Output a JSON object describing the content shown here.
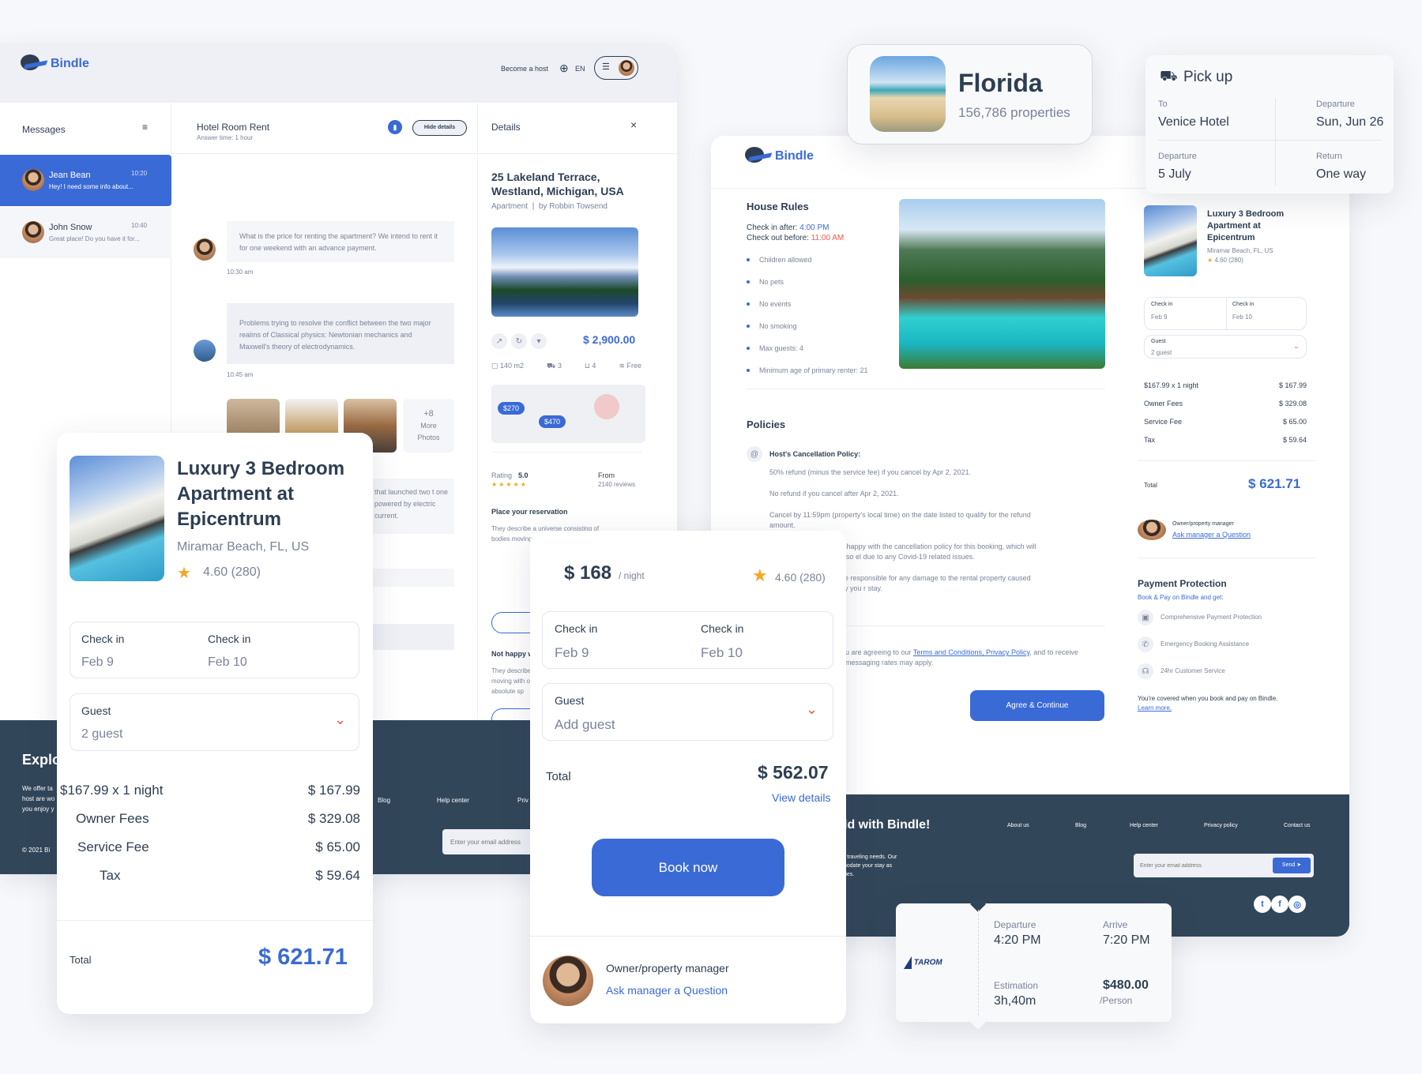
{
  "colors": {
    "accent": "#3a6ad6",
    "dark": "#32465a",
    "warning": "#f2594b",
    "star": "#f5a623"
  },
  "chat_app": {
    "brand": "Bindle",
    "become_host": "Become a host",
    "language": "EN",
    "messages_title": "Messages",
    "conversations": [
      {
        "name": "Jean Bean",
        "time": "10:20",
        "preview": "Hey! I need some info about..."
      },
      {
        "name": "John Snow",
        "time": "10:40",
        "preview": "Great place! Do you have it for..."
      }
    ],
    "chat": {
      "title": "Hotel Room Rent",
      "subtitle": "Answer time: 1 hour",
      "hide_details": "Hide details",
      "messages": [
        {
          "text": "What is the price for renting the apartment? We intend to rent it for one weekend with an advance payment.",
          "time": "10:30 am"
        },
        {
          "text": "Problems trying to resolve the conflict between the two major realms of Classical physics: Newtonian mechanics and Maxwell's theory of electrodynamics.",
          "time": "10:45 am"
        },
        {
          "text": "that launched two t one powered by electric current."
        }
      ],
      "more_photos": "+8",
      "more_photos_label": "More Photos"
    },
    "details": {
      "title": "Details",
      "address": "25 Lakeland Terrace, Westland, Michigan, USA",
      "type": "Apartment",
      "by": "by Robbin Towsend",
      "price": "$ 2,900.00",
      "amenities": [
        "140 m2",
        "3",
        "4",
        "Free"
      ],
      "map_pins": [
        "$270",
        "$470"
      ],
      "rating_label": "Rating",
      "rating": "5.0",
      "from_label": "From",
      "reviews": "2140 reviews",
      "reservation_title": "Place your reservation",
      "reservation_text": "They describe a universe consisting of bodies moving with ... of absolute sp",
      "not_happy_title": "Not happy w",
      "not_happy_text": "They describe moving with of absolute sp"
    },
    "footer": {
      "heading": "Explo",
      "text": "We offer ta host are wo you enjoy y",
      "copyright": "© 2021 Bi",
      "links": [
        "Blog",
        "Help center",
        "Priv"
      ],
      "email_placeholder": "Enter your email address"
    }
  },
  "florida": {
    "title": "Florida",
    "count": "156,786 properties"
  },
  "pickup": {
    "title": "Pick up",
    "to_label": "To",
    "to": "Venice Hotel",
    "dep_label": "Departure",
    "dep": "Sun, Jun 26",
    "dep2_label": "Departure",
    "dep2": "5 July",
    "ret_label": "Return",
    "ret": "One way"
  },
  "booking_page": {
    "brand": "Bindle",
    "house_rules": {
      "title": "House Rules",
      "checkin_label": "Check in after:",
      "checkin": "4:00 PM",
      "checkout_label": "Check out before:",
      "checkout": "11:00 AM",
      "rules": [
        "Children allowed",
        "No pets",
        "No events",
        "No smoking",
        "Max guests: 4",
        "Minimum age of primary renter: 21"
      ]
    },
    "policies": {
      "title": "Policies",
      "host_policy": "Host's Cancellation Policy:",
      "lines": [
        "50% refund (minus the service fee) if you cancel by Apr 2, 2021.",
        "No refund if you cancel after Apr 2, 2021.",
        "Cancel by 11:59pm (property's local time) on the date listed to qualify for the refund amount.",
        "e happy with the cancellation policy for this booking, which will also el due to any Covid-19 related issues.",
        "be responsible for any damage to the rental property caused by you r stay."
      ],
      "agree_prefix": "u are agreeing to our ",
      "terms": "Terms and Conditions, Privacy Policy",
      "agree_suffix": ", and to receive messaging rates may apply.",
      "agree_button": "Agree & Continue"
    },
    "summary": {
      "title": "Luxury 3 Bedroom Apartment at Epicentrum",
      "location": "Miramar Beach, FL, US",
      "rating": "4.60 (280)",
      "checkin_label": "Check in",
      "checkin": "Feb 9",
      "checkout_label": "Check in",
      "checkout": "Feb 10",
      "guest_label": "Guest",
      "guest": "2 guest",
      "lines": [
        {
          "label": "$167.99 x 1 night",
          "value": "$ 167.99"
        },
        {
          "label": "Owner Fees",
          "value": "$ 329.08"
        },
        {
          "label": "Service Fee",
          "value": "$ 65.00"
        },
        {
          "label": "Tax",
          "value": "$ 59.64"
        }
      ],
      "total_label": "Total",
      "total": "$ 621.71",
      "manager_label": "Owner/property manager",
      "manager_link": "Ask manager a Question"
    },
    "protection": {
      "title": "Payment Protection",
      "subtitle": "Book & Pay on Bindle and get:",
      "items": [
        "Comprehensive Payment Protection",
        "Emergency Booking Assistance",
        "24hr Customer Service"
      ],
      "note": "You're covered when you book and pay on Bindle.",
      "learn_more": "Learn more."
    },
    "footer": {
      "heading": "ld with Bindle!",
      "text": "r traveling needs. Our nodate your stay as ries.",
      "links": [
        "About us",
        "Blog",
        "Help center",
        "Privacy policy",
        "Contact us"
      ],
      "email_placeholder": "Enter your email address",
      "send": "Send"
    }
  },
  "left_card": {
    "title": "Luxury 3 Bedroom Apartment at Epicentrum",
    "location": "Miramar Beach, FL, US",
    "rating": "4.60 (280)",
    "checkin_label": "Check in",
    "checkin": "Feb 9",
    "checkout_label": "Check in",
    "checkout": "Feb 10",
    "guest_label": "Guest",
    "guest": "2 guest",
    "lines": [
      {
        "label": "$167.99 x 1 night",
        "value": "$ 167.99"
      },
      {
        "label": "Owner Fees",
        "value": "$ 329.08"
      },
      {
        "label": "Service Fee",
        "value": "$ 65.00"
      },
      {
        "label": "Tax",
        "value": "$ 59.64"
      }
    ],
    "total_label": "Total",
    "total": "$ 621.71"
  },
  "middle_card": {
    "price": "$ 168",
    "per": "/ night",
    "rating": "4.60 (280)",
    "checkin_label": "Check in",
    "checkin": "Feb 9",
    "checkout_label": "Check in",
    "checkout": "Feb 10",
    "guest_label": "Guest",
    "guest_placeholder": "Add guest",
    "total_label": "Total",
    "total": "$ 562.07",
    "view_details": "View details",
    "book": "Book now",
    "manager_label": "Owner/property manager",
    "manager_link": "Ask manager a Question"
  },
  "flight": {
    "airline": "TAROM",
    "dep_label": "Departure",
    "dep": "4:20 PM",
    "arr_label": "Arrive",
    "arr": "7:20 PM",
    "est_label": "Estimation",
    "est": "3h,40m",
    "price": "$480.00",
    "per": "/Person"
  }
}
